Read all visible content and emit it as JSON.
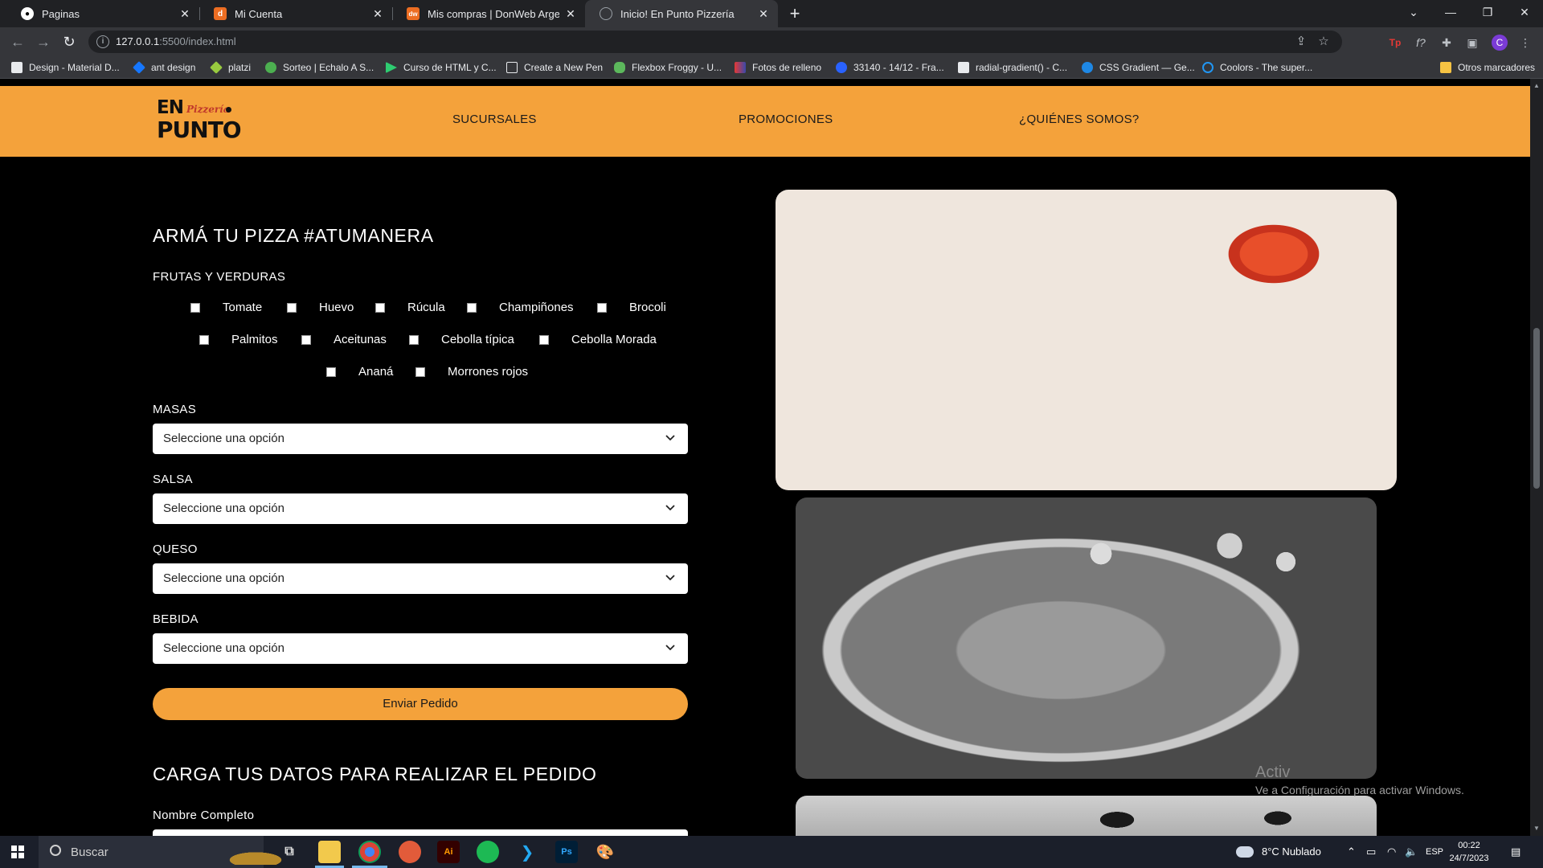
{
  "browser": {
    "tabs": [
      {
        "title": "Paginas",
        "icon": "github-icon",
        "active": false
      },
      {
        "title": "Mi Cuenta",
        "icon": "donweb-d-icon",
        "active": false
      },
      {
        "title": "Mis compras | DonWeb Argentina",
        "icon": "donweb-dw-icon",
        "active": false
      },
      {
        "title": "Inicio! En Punto Pizzería",
        "icon": "globe-icon",
        "active": true
      }
    ],
    "url_host": "127.0.0.1",
    "url_path": ":5500/index.html",
    "bookmarks": [
      "Design - Material D...",
      "ant design",
      "platzi",
      "Sorteo | Echalo A S...",
      "Curso de HTML y C...",
      "Create a New Pen",
      "Flexbox Froggy - U...",
      "Fotos de relleno",
      "33140 - 14/12 - Fra...",
      "radial-gradient() - C...",
      "CSS Gradient — Ge...",
      "Coolors - The super..."
    ],
    "other_bookmarks": "Otros marcadores",
    "profile_initial": "C"
  },
  "site": {
    "logo": {
      "line1": "EN",
      "tag": "Pizzería",
      "line2": "PUNTO"
    },
    "nav": [
      "SUCURSALES",
      "PROMOCIONES",
      "¿QUIÉNES SOMOS?"
    ],
    "builder_title": "ARMÁ TU PIZZA #ATUMANERA",
    "toppings_label": "FRUTAS Y VERDURAS",
    "toppings_row1": [
      "Tomate",
      "Huevo",
      "Rúcula",
      "Champiñones",
      "Brocoli"
    ],
    "toppings_row2": [
      "Palmitos",
      "Aceitunas",
      "Cebolla típica",
      "Cebolla Morada"
    ],
    "toppings_row3": [
      "Ananá",
      "Morrones rojos"
    ],
    "selects": [
      {
        "label": "MASAS",
        "value": "Seleccione una opción"
      },
      {
        "label": "SALSA",
        "value": "Seleccione una opción"
      },
      {
        "label": "QUESO",
        "value": "Seleccione una opción"
      },
      {
        "label": "BEBIDA",
        "value": "Seleccione una opción"
      }
    ],
    "send_button": "Enviar Pedido",
    "data_title": "CARGA TUS DATOS PARA REALIZAR EL PEDIDO",
    "name_label": "Nombre Completo",
    "activate_title": "Activ",
    "activate_text": "Ve a Configuración para activar Windows.",
    "accent_color": "#f4a23b"
  },
  "taskbar": {
    "search_label": "Buscar",
    "weather": "8°C  Nublado",
    "language": "ESP",
    "time": "00:22",
    "date": "24/7/2023"
  }
}
